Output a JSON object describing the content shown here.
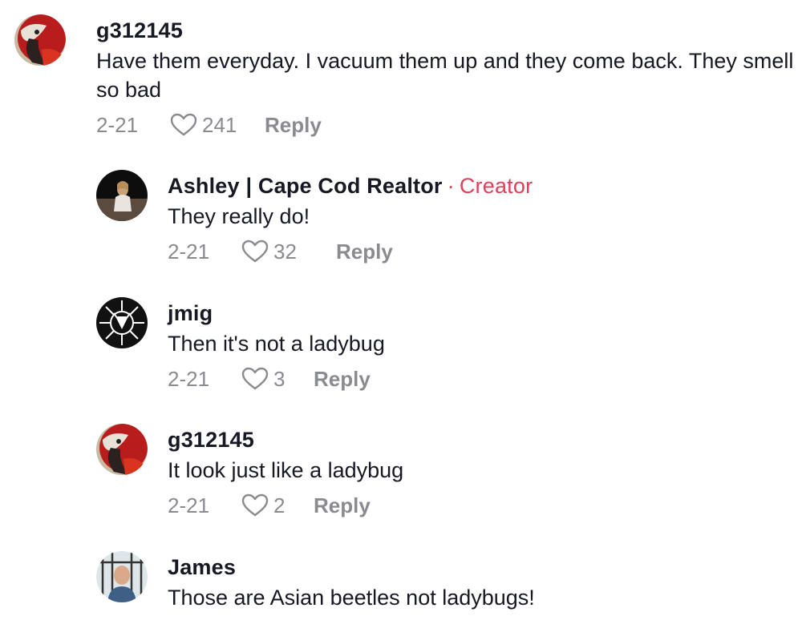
{
  "comments": [
    {
      "username": "g312145",
      "text": "Have them everyday. I vacuum them up and they come back. They smell so bad",
      "date": "2-21",
      "likes": "241",
      "reply_label": "Reply",
      "avatar": "parrot-avatar"
    },
    {
      "username": "Ashley | Cape Cod Realtor",
      "creator_sep": "·",
      "creator_label": "Creator",
      "text": "They really do!",
      "date": "2-21",
      "likes": "32",
      "reply_label": "Reply",
      "avatar": "person-avatar"
    },
    {
      "username": "jmig",
      "text": "Then it's not a ladybug",
      "date": "2-21",
      "likes": "3",
      "reply_label": "Reply",
      "avatar": "emblem-avatar"
    },
    {
      "username": "g312145",
      "text": "It look just like a ladybug",
      "date": "2-21",
      "likes": "2",
      "reply_label": "Reply",
      "avatar": "parrot-avatar"
    },
    {
      "username": "James",
      "text": "Those are Asian beetles not ladybugs!",
      "avatar": "man-avatar"
    }
  ],
  "colors": {
    "creator": "#e0405a",
    "meta": "#8a8b91",
    "text": "#161823"
  }
}
